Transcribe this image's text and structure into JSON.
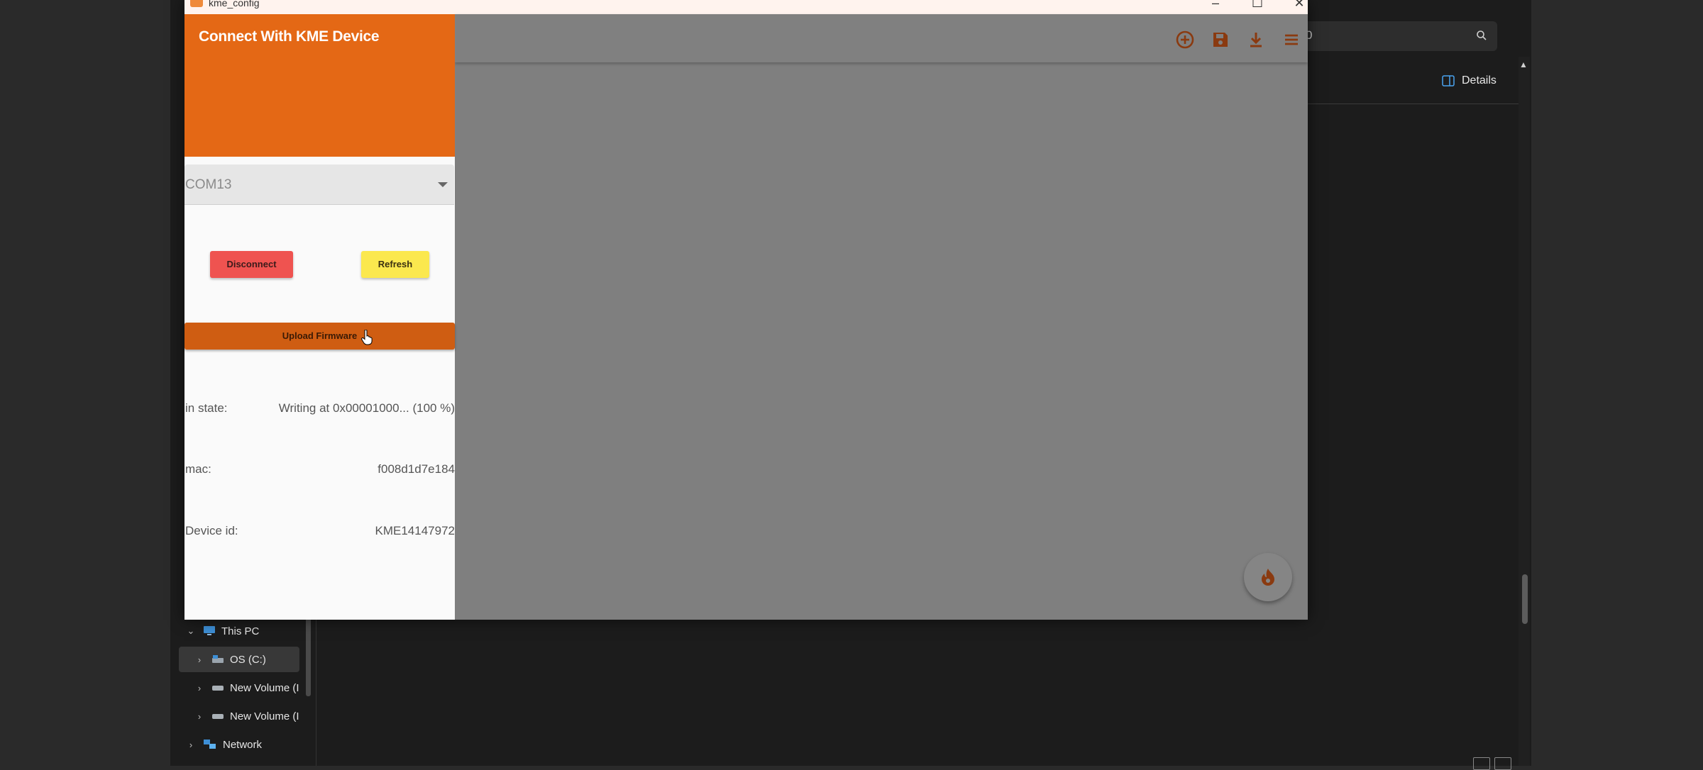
{
  "explorer": {
    "search_text": "0",
    "details_label": "Details",
    "tree": [
      {
        "label": "This PC",
        "expanded": true
      },
      {
        "label": "OS (C:)",
        "selected": true
      },
      {
        "label": "New Volume (I"
      },
      {
        "label": "New Volume (I"
      },
      {
        "label": "Network"
      }
    ]
  },
  "app": {
    "window_title": "kme_config",
    "drawer_title": "Connect With KME Device",
    "com_port": "COM13",
    "disconnect_label": "Disconnect",
    "refresh_label": "Refresh",
    "upload_label": "Upload Firmware",
    "info": [
      {
        "label": "in state:",
        "value": "Writing at 0x00001000... (100 %)"
      },
      {
        "label": "mac:",
        "value": "f008d1d7e184"
      },
      {
        "label": "Device id:",
        "value": "KME14147972"
      }
    ],
    "appbar_icons": [
      "add-circle-icon",
      "save-icon",
      "download-icon",
      "menu-icon"
    ],
    "fab_icon": "flame-icon"
  },
  "colors": {
    "accent": "#e46815",
    "upload_button": "#cf5d12",
    "disconnect_button": "#ef5350",
    "refresh_button": "#fbe84e",
    "overlay": "#7f7f7f"
  }
}
